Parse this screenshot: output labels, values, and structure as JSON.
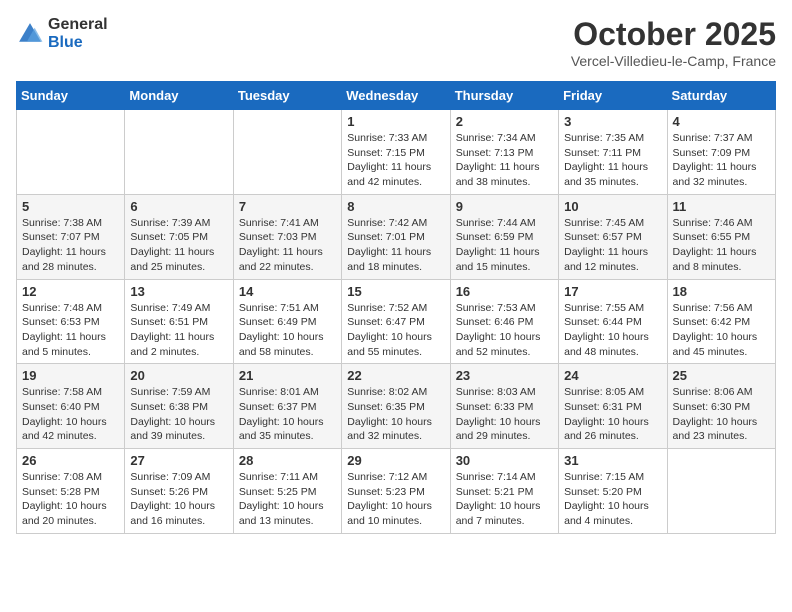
{
  "header": {
    "logo_general": "General",
    "logo_blue": "Blue",
    "month_title": "October 2025",
    "location": "Vercel-Villedieu-le-Camp, France"
  },
  "weekdays": [
    "Sunday",
    "Monday",
    "Tuesday",
    "Wednesday",
    "Thursday",
    "Friday",
    "Saturday"
  ],
  "weeks": [
    [
      {
        "day": "",
        "info": ""
      },
      {
        "day": "",
        "info": ""
      },
      {
        "day": "",
        "info": ""
      },
      {
        "day": "1",
        "info": "Sunrise: 7:33 AM\nSunset: 7:15 PM\nDaylight: 11 hours\nand 42 minutes."
      },
      {
        "day": "2",
        "info": "Sunrise: 7:34 AM\nSunset: 7:13 PM\nDaylight: 11 hours\nand 38 minutes."
      },
      {
        "day": "3",
        "info": "Sunrise: 7:35 AM\nSunset: 7:11 PM\nDaylight: 11 hours\nand 35 minutes."
      },
      {
        "day": "4",
        "info": "Sunrise: 7:37 AM\nSunset: 7:09 PM\nDaylight: 11 hours\nand 32 minutes."
      }
    ],
    [
      {
        "day": "5",
        "info": "Sunrise: 7:38 AM\nSunset: 7:07 PM\nDaylight: 11 hours\nand 28 minutes."
      },
      {
        "day": "6",
        "info": "Sunrise: 7:39 AM\nSunset: 7:05 PM\nDaylight: 11 hours\nand 25 minutes."
      },
      {
        "day": "7",
        "info": "Sunrise: 7:41 AM\nSunset: 7:03 PM\nDaylight: 11 hours\nand 22 minutes."
      },
      {
        "day": "8",
        "info": "Sunrise: 7:42 AM\nSunset: 7:01 PM\nDaylight: 11 hours\nand 18 minutes."
      },
      {
        "day": "9",
        "info": "Sunrise: 7:44 AM\nSunset: 6:59 PM\nDaylight: 11 hours\nand 15 minutes."
      },
      {
        "day": "10",
        "info": "Sunrise: 7:45 AM\nSunset: 6:57 PM\nDaylight: 11 hours\nand 12 minutes."
      },
      {
        "day": "11",
        "info": "Sunrise: 7:46 AM\nSunset: 6:55 PM\nDaylight: 11 hours\nand 8 minutes."
      }
    ],
    [
      {
        "day": "12",
        "info": "Sunrise: 7:48 AM\nSunset: 6:53 PM\nDaylight: 11 hours\nand 5 minutes."
      },
      {
        "day": "13",
        "info": "Sunrise: 7:49 AM\nSunset: 6:51 PM\nDaylight: 11 hours\nand 2 minutes."
      },
      {
        "day": "14",
        "info": "Sunrise: 7:51 AM\nSunset: 6:49 PM\nDaylight: 10 hours\nand 58 minutes."
      },
      {
        "day": "15",
        "info": "Sunrise: 7:52 AM\nSunset: 6:47 PM\nDaylight: 10 hours\nand 55 minutes."
      },
      {
        "day": "16",
        "info": "Sunrise: 7:53 AM\nSunset: 6:46 PM\nDaylight: 10 hours\nand 52 minutes."
      },
      {
        "day": "17",
        "info": "Sunrise: 7:55 AM\nSunset: 6:44 PM\nDaylight: 10 hours\nand 48 minutes."
      },
      {
        "day": "18",
        "info": "Sunrise: 7:56 AM\nSunset: 6:42 PM\nDaylight: 10 hours\nand 45 minutes."
      }
    ],
    [
      {
        "day": "19",
        "info": "Sunrise: 7:58 AM\nSunset: 6:40 PM\nDaylight: 10 hours\nand 42 minutes."
      },
      {
        "day": "20",
        "info": "Sunrise: 7:59 AM\nSunset: 6:38 PM\nDaylight: 10 hours\nand 39 minutes."
      },
      {
        "day": "21",
        "info": "Sunrise: 8:01 AM\nSunset: 6:37 PM\nDaylight: 10 hours\nand 35 minutes."
      },
      {
        "day": "22",
        "info": "Sunrise: 8:02 AM\nSunset: 6:35 PM\nDaylight: 10 hours\nand 32 minutes."
      },
      {
        "day": "23",
        "info": "Sunrise: 8:03 AM\nSunset: 6:33 PM\nDaylight: 10 hours\nand 29 minutes."
      },
      {
        "day": "24",
        "info": "Sunrise: 8:05 AM\nSunset: 6:31 PM\nDaylight: 10 hours\nand 26 minutes."
      },
      {
        "day": "25",
        "info": "Sunrise: 8:06 AM\nSunset: 6:30 PM\nDaylight: 10 hours\nand 23 minutes."
      }
    ],
    [
      {
        "day": "26",
        "info": "Sunrise: 7:08 AM\nSunset: 5:28 PM\nDaylight: 10 hours\nand 20 minutes."
      },
      {
        "day": "27",
        "info": "Sunrise: 7:09 AM\nSunset: 5:26 PM\nDaylight: 10 hours\nand 16 minutes."
      },
      {
        "day": "28",
        "info": "Sunrise: 7:11 AM\nSunset: 5:25 PM\nDaylight: 10 hours\nand 13 minutes."
      },
      {
        "day": "29",
        "info": "Sunrise: 7:12 AM\nSunset: 5:23 PM\nDaylight: 10 hours\nand 10 minutes."
      },
      {
        "day": "30",
        "info": "Sunrise: 7:14 AM\nSunset: 5:21 PM\nDaylight: 10 hours\nand 7 minutes."
      },
      {
        "day": "31",
        "info": "Sunrise: 7:15 AM\nSunset: 5:20 PM\nDaylight: 10 hours\nand 4 minutes."
      },
      {
        "day": "",
        "info": ""
      }
    ]
  ]
}
